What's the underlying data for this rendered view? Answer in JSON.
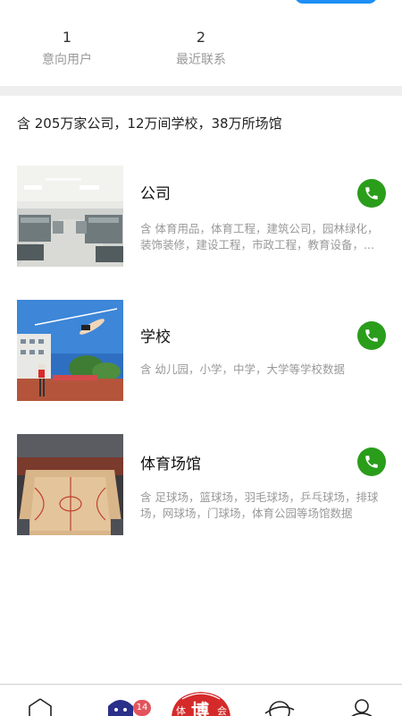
{
  "stats": [
    {
      "value": "1",
      "label": "意向用户"
    },
    {
      "value": "2",
      "label": "最近联系"
    }
  ],
  "summary": "含 205万家公司，12万间学校，38万所场馆",
  "categories": [
    {
      "title": "公司",
      "desc": "含 体育用品，体育工程，建筑公司，园林绿化，装饰装修，建设工程，市政工程，教育设备，..."
    },
    {
      "title": "学校",
      "desc": "含 幼儿园，小学，中学，大学等学校数据"
    },
    {
      "title": "体育场馆",
      "desc": "含 足球场，篮球场，羽毛球场，乒乓球场，排球场，网球场，门球场，体育公园等场馆数据"
    }
  ],
  "tabbar": {
    "badge": "14",
    "center_glyph": "博",
    "center_left": "体",
    "center_right": "会"
  },
  "colors": {
    "accent": "#1e8ff5",
    "call": "#2a9d1b",
    "badge": "#e2545c"
  }
}
